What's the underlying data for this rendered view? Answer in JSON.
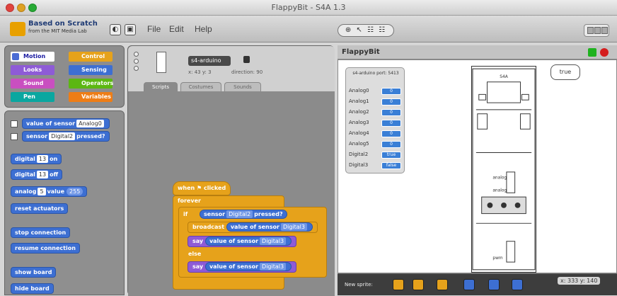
{
  "window": {
    "title": "FlappyBit - S4A 1.3",
    "controls": [
      "close",
      "minimize",
      "zoom"
    ]
  },
  "menubar": {
    "logo_title": "Based on Scratch",
    "logo_subtitle": "from the MIT Media Lab",
    "items": [
      "File",
      "Edit",
      "Help"
    ],
    "tools_label": "⊕ ↖ ☷ ☷"
  },
  "categories": [
    {
      "label": "Motion",
      "color": "#4a6cd4",
      "active": true
    },
    {
      "label": "Control",
      "color": "#e6a21b",
      "active": false
    },
    {
      "label": "Looks",
      "color": "#8e5bd6",
      "active": false
    },
    {
      "label": "Sensing",
      "color": "#3d6fd2",
      "active": false
    },
    {
      "label": "Sound",
      "color": "#c94fc0",
      "active": false
    },
    {
      "label": "Operators",
      "color": "#5cb712",
      "active": false
    },
    {
      "label": "Pen",
      "color": "#0aa7a0",
      "active": false
    },
    {
      "label": "Variables",
      "color": "#ee7d16",
      "active": false
    }
  ],
  "palette": {
    "blocks": [
      {
        "label": "value of sensor",
        "arg": "Analog0",
        "checkbox": true
      },
      {
        "label": "sensor",
        "arg": "Digital2",
        "suffix": "pressed?",
        "checkbox": true
      },
      {
        "label": "digital",
        "arg": "13",
        "suffix": "on"
      },
      {
        "label": "digital",
        "arg": "13",
        "suffix": "off"
      },
      {
        "label": "analog",
        "arg": "5",
        "suffix": "value",
        "extra": "255"
      },
      {
        "label": "reset actuators"
      },
      {
        "label": "stop connection"
      },
      {
        "label": "resume connection"
      },
      {
        "label": "show board"
      },
      {
        "label": "hide board"
      }
    ]
  },
  "sprite": {
    "name": "s4-arduino",
    "coords": "x: 43  y: 3",
    "direction": "direction: 90",
    "tabs": [
      "Scripts",
      "Costumes",
      "Sounds"
    ]
  },
  "script": {
    "hat": "when ⚑ clicked",
    "forever": "forever",
    "if": "if",
    "condition": "sensor",
    "condition_arg": "Digital2",
    "condition_suffix": "pressed?",
    "broadcast": "broadcast",
    "broadcast_value": "value of sensor",
    "broadcast_arg": "Digital3",
    "say1": "say",
    "say1_value": "value of sensor",
    "say1_arg": "Digital3",
    "else": "else",
    "say2": "say",
    "say2_value": "value of sensor",
    "say2_arg": "Digital3"
  },
  "stage": {
    "title": "FlappyBit",
    "speech": "true",
    "watcher_title": "s4-arduino\nport: 5413",
    "watcher_rows": [
      {
        "label": "Analog0",
        "value": "0"
      },
      {
        "label": "Analog1",
        "value": "0"
      },
      {
        "label": "Analog2",
        "value": "0"
      },
      {
        "label": "Analog3",
        "value": "0"
      },
      {
        "label": "Analog4",
        "value": "0"
      },
      {
        "label": "Analog5",
        "value": "0"
      },
      {
        "label": "Digital2",
        "value": "true"
      },
      {
        "label": "Digital3",
        "value": "false"
      }
    ],
    "board_labels": {
      "top": "S4A",
      "mid1": "analog",
      "mid2": "analog",
      "bottom": "pwm"
    }
  },
  "corral": {
    "label": "New sprite:",
    "coords": "x: 333   y: 140"
  }
}
